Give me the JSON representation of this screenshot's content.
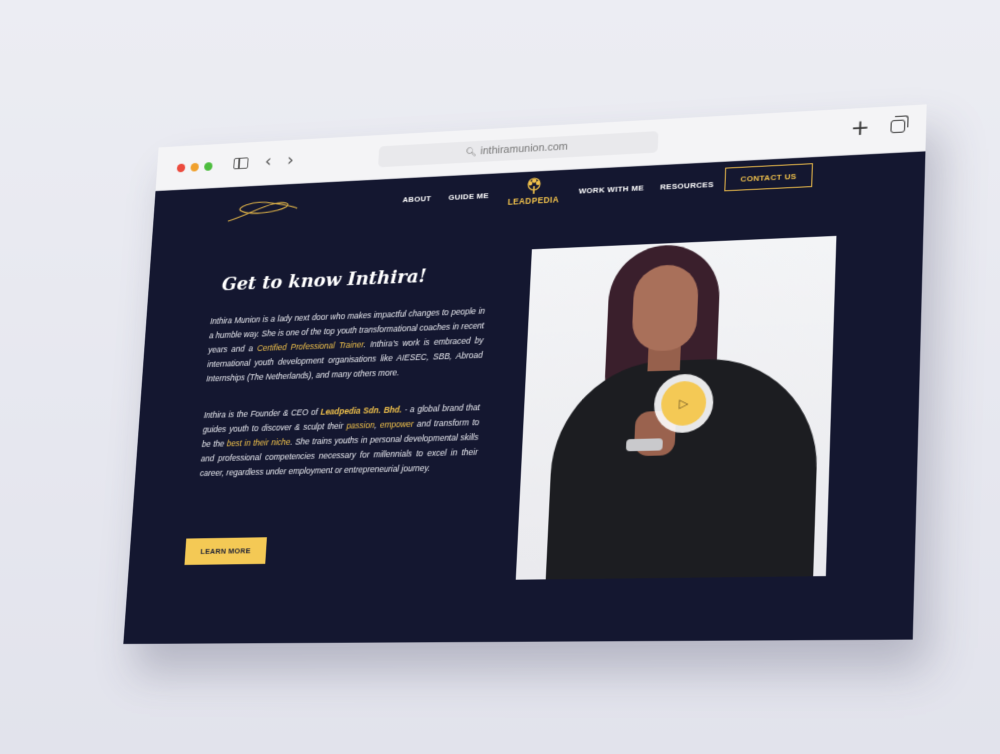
{
  "browser": {
    "url": "inthiramunion.com",
    "icons": [
      "close-dot",
      "minimize-dot",
      "maximize-dot",
      "sidebar-icon",
      "chevron-left-icon",
      "chevron-right-icon",
      "lock-icon",
      "plus-icon",
      "tabs-icon"
    ]
  },
  "header": {
    "nav": {
      "about": "ABOUT",
      "guide": "GUIDE ME",
      "work": "WORK WITH ME",
      "resources": "RESOURCES"
    },
    "brand": "LEADPEDIA",
    "contact": "CONTACT US"
  },
  "hero": {
    "title": "Get to know Inthira!",
    "para1": {
      "a": "Inthira Munion is a lady next door who makes impactful changes to people in a humble way. She is one of the top youth transformational coaches in recent years and a ",
      "hl": "Certified Professional Trainer",
      "b": ". Inthira's work is embraced by international youth development organisations like AIESEC, SBB, Abroad Internships (The Netherlands), and many others more."
    },
    "para2": {
      "a": "Inthira is the Founder & CEO of ",
      "company": "Leadpedia Sdn. Bhd.",
      "b": " - a global brand that guides youth to discover & sculpt their ",
      "passion": "passion",
      "c": ", ",
      "empower": "empower",
      "d": " and transform to be the ",
      "niche": "best in their niche",
      "e": ". She trains youths in personal developmental skills and professional competencies necessary for millennials to excel in their career, regardless under employment or entrepreneurial journey."
    },
    "learn_more": "LEARN MORE"
  },
  "colors": {
    "background": "#141730",
    "accent": "#f0c14b",
    "button": "#f4c955"
  }
}
